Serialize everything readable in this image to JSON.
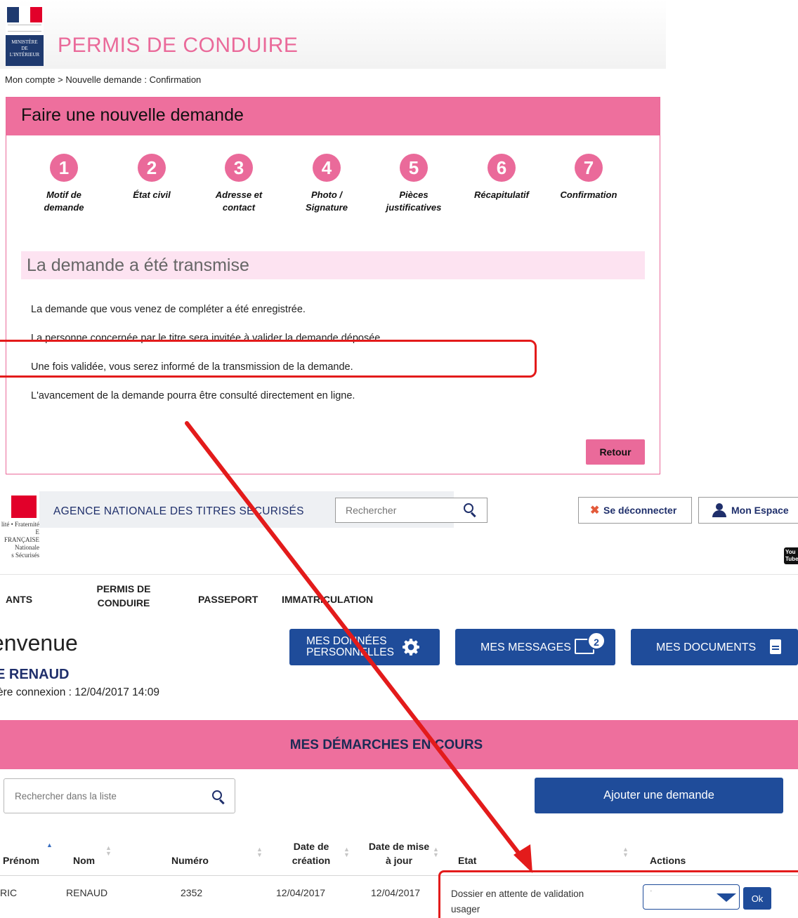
{
  "top": {
    "logo": {
      "ministry": [
        "MINISTÈRE",
        "DE",
        "L'INTÉRIEUR"
      ]
    },
    "title": "PERMIS DE CONDUIRE",
    "breadcrumb": "Mon compte > Nouvelle demande : Confirmation",
    "panel_title": "Faire une nouvelle demande",
    "steps": [
      {
        "num": "1",
        "label": "Motif de demande"
      },
      {
        "num": "2",
        "label": "État civil"
      },
      {
        "num": "3",
        "label": "Adresse et contact"
      },
      {
        "num": "4",
        "label": "Photo / Signature"
      },
      {
        "num": "5",
        "label": "Pièces justificatives"
      },
      {
        "num": "6",
        "label": "Récapitulatif"
      },
      {
        "num": "7",
        "label": "Confirmation"
      }
    ],
    "success_title": "La demande a été transmise",
    "messages": [
      "La demande que vous venez de compléter a été enregistrée.",
      "La personne concernée par le titre sera invitée à valider la demande déposée.",
      "Une fois validée, vous serez informé de la transmission de la demande.",
      "L'avancement de la demande pourra être consulté directement en ligne."
    ],
    "retour_label": "Retour"
  },
  "portal": {
    "logo_lines": [
      "lité • Fraternité",
      "E FRANÇAISE",
      "Nationale",
      "s Sécurisés"
    ],
    "agency": "AGENCE NATIONALE DES TITRES SÉCURISÉS",
    "search_placeholder": "Rechercher",
    "logout_label": "Se déconnecter",
    "myspace_label": "Mon Espace",
    "youtube_label": "You Tube",
    "nav": [
      "ANTS",
      "PERMIS DE CONDUIRE",
      "PASSEPORT",
      "IMMATRICULATION"
    ],
    "welcome": "envenue",
    "user_name": "E RENAUD",
    "last_login": "ère connexion : 12/04/2017 14:09",
    "btn_data": "MES DONNÉES PERSONNELLES",
    "btn_messages": "MES MESSAGES",
    "messages_count": "2",
    "btn_documents": "MES DOCUMENTS",
    "section_title": "MES DÉMARCHES EN COURS",
    "list_search_placeholder": "Rechercher dans la liste",
    "add_request_label": "Ajouter une demande",
    "table": {
      "headers": [
        "Prénom",
        "Nom",
        "Numéro",
        "Date de création",
        "Date de mise à jour",
        "Etat",
        "Actions"
      ],
      "rows": [
        {
          "prenom": "RIC",
          "nom": "RENAUD",
          "numero": "2352",
          "creation": "12/04/2017",
          "maj": "12/04/2017",
          "etat": "Dossier en attente de validation usager",
          "select": "'",
          "ok": "Ok"
        }
      ]
    }
  },
  "colors": {
    "pink": "#ee6f9d",
    "navy": "#1f4c9a",
    "annotation": "#e31b1b"
  }
}
